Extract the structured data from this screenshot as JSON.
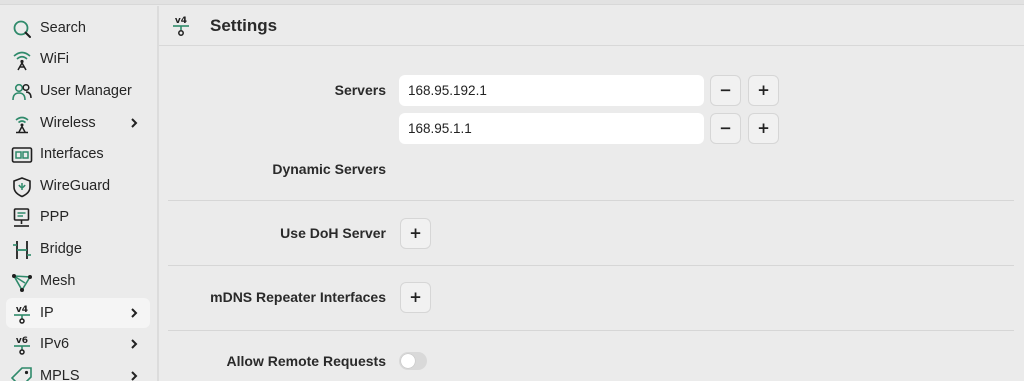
{
  "colors": {
    "accent": "#2f8a6b",
    "icon_text": "#1f1f1f"
  },
  "sidebar": {
    "items": [
      {
        "label": "Search",
        "icon": "search-icon"
      },
      {
        "label": "WiFi",
        "icon": "wifi-icon"
      },
      {
        "label": "User Manager",
        "icon": "users-icon"
      },
      {
        "label": "Wireless",
        "icon": "wireless-icon",
        "submenu": true
      },
      {
        "label": "Interfaces",
        "icon": "interfaces-icon"
      },
      {
        "label": "WireGuard",
        "icon": "wireguard-shield-icon"
      },
      {
        "label": "PPP",
        "icon": "ppp-icon"
      },
      {
        "label": "Bridge",
        "icon": "bridge-icon"
      },
      {
        "label": "Mesh",
        "icon": "mesh-icon"
      },
      {
        "label": "IP",
        "icon": "ipv4-icon",
        "submenu": true,
        "active": true
      },
      {
        "label": "IPv6",
        "icon": "ipv6-icon",
        "submenu": true
      },
      {
        "label": "MPLS",
        "icon": "mpls-tag-icon",
        "submenu": true
      }
    ]
  },
  "header": {
    "title": "Settings",
    "icon_text": "v4"
  },
  "form": {
    "servers_label": "Servers",
    "servers": [
      "168.95.192.1",
      "168.95.1.1"
    ],
    "remove_label": "−",
    "add_label": "+",
    "dynamic_servers_label": "Dynamic Servers",
    "use_doh_label": "Use DoH Server",
    "mdns_label": "mDNS Repeater Interfaces",
    "allow_remote_label": "Allow Remote Requests",
    "allow_remote_value": false
  }
}
